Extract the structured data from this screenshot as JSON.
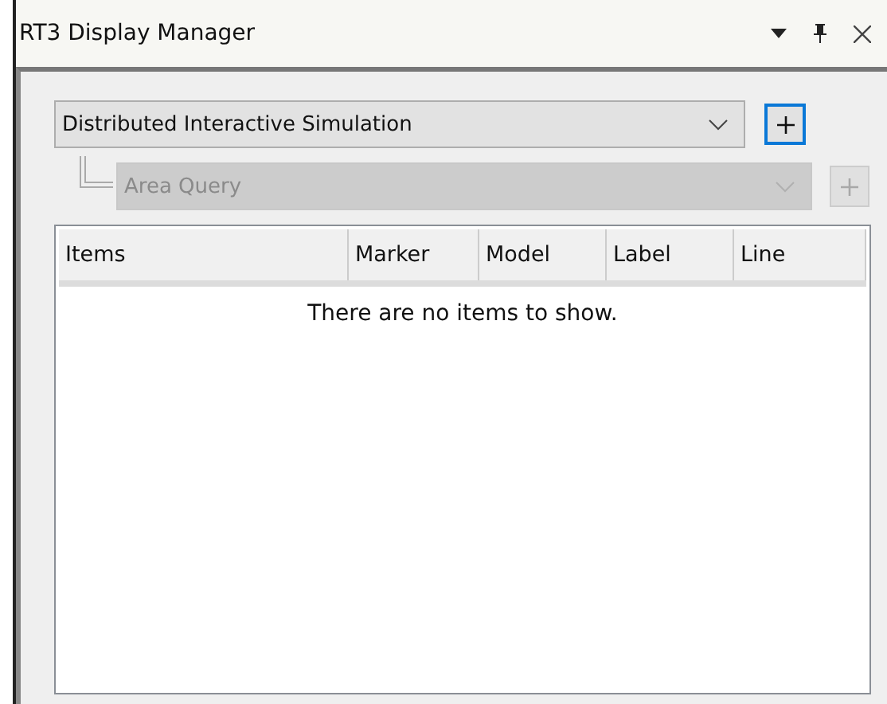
{
  "window": {
    "title": "RT3 Display Manager"
  },
  "selectors": [
    {
      "value": "Distributed Interactive Simulation",
      "disabled": false,
      "focused": true,
      "child": false
    },
    {
      "value": "Area Query",
      "disabled": true,
      "focused": false,
      "child": true
    }
  ],
  "table": {
    "columns": [
      "Items",
      "Marker",
      "Model",
      "Label",
      "Line"
    ],
    "empty_message": "There are no items to show."
  }
}
